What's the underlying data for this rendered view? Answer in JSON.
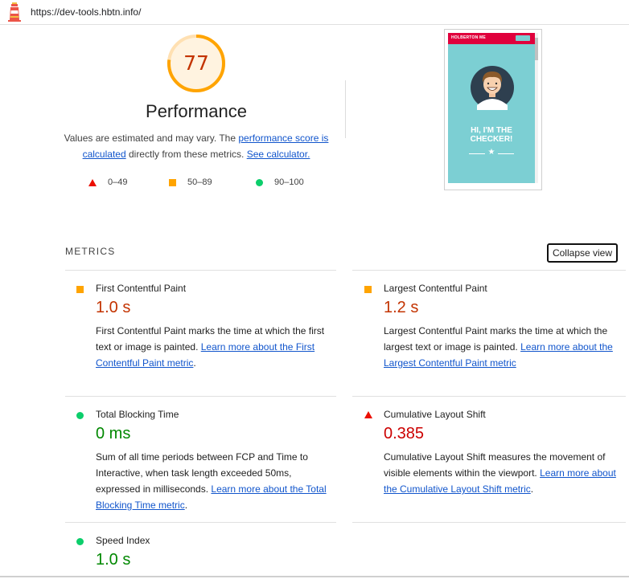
{
  "topbar": {
    "url": "https://dev-tools.hbtn.info/"
  },
  "summary": {
    "score": "77",
    "title": "Performance",
    "desc_text_1": "Values are estimated and may vary. The ",
    "desc_link_1": "performance score is calculated",
    "desc_text_2": " directly from these metrics. ",
    "desc_link_2": "See calculator.",
    "score_fraction": 0.77,
    "score_color": "#ffa400"
  },
  "legend": [
    {
      "label": "0–49",
      "color": "#eb0f00"
    },
    {
      "label": "50–89",
      "color": "#ffa400"
    },
    {
      "label": "90–100",
      "color": "#0cce6b"
    }
  ],
  "screenshot": {
    "brand": "HOLBERTON ME",
    "headline_1": "HI, I'M THE",
    "headline_2": "CHECKER!"
  },
  "metrics": {
    "title": "METRICS",
    "collapse_label": "Collapse view",
    "items": [
      {
        "name": "First Contentful Paint",
        "value": "1.0 s",
        "rating": "average",
        "desc": "First Contentful Paint marks the time at which the first text or image is painted. ",
        "link": "Learn more about the First Contentful Paint metric"
      },
      {
        "name": "Largest Contentful Paint",
        "value": "1.2 s",
        "rating": "average",
        "desc": "Largest Contentful Paint marks the time at which the largest text or image is painted. ",
        "link": "Learn more about the Largest Contentful Paint metric"
      },
      {
        "name": "Total Blocking Time",
        "value": "0 ms",
        "rating": "pass",
        "desc": "Sum of all time periods between FCP and Time to Interactive, when task length exceeded 50ms, expressed in milliseconds. ",
        "link": "Learn more about the Total Blocking Time metric"
      },
      {
        "name": "Cumulative Layout Shift",
        "value": "0.385",
        "rating": "fail",
        "desc": "Cumulative Layout Shift measures the movement of visible elements within the viewport. ",
        "link": "Learn more about the Cumulative Layout Shift metric"
      },
      {
        "name": "Speed Index",
        "value": "1.0 s",
        "rating": "pass",
        "desc": "",
        "link": ""
      }
    ]
  },
  "colors": {
    "fail": "#eb0f00",
    "average": "#ffa400",
    "pass": "#0cce6b",
    "link": "#1155cc"
  }
}
